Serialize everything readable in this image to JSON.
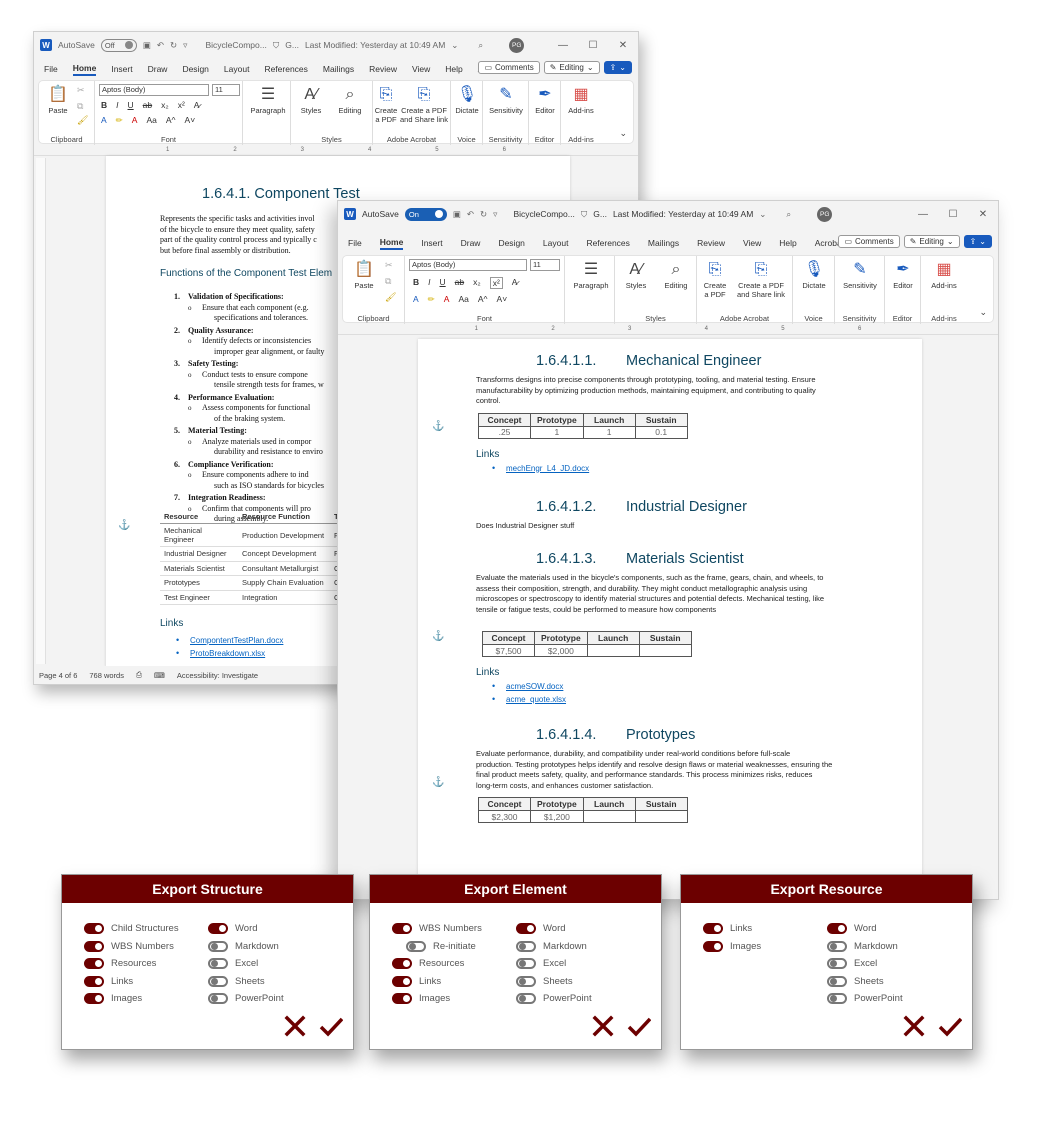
{
  "colors": {
    "accent": "#185abd",
    "dialog_header": "#6c0000",
    "heading": "#0f4761",
    "link": "#0563c1"
  },
  "word_common": {
    "autosave_label": "AutoSave",
    "title_short": "BicycleCompo...",
    "g_label": "G...",
    "last_modified": "Last Modified: Yesterday at 10:49 AM",
    "user_initials": "PG",
    "menu": [
      "File",
      "Home",
      "Insert",
      "Draw",
      "Design",
      "Layout",
      "References",
      "Mailings",
      "Review",
      "View",
      "Help",
      "Acrobat"
    ],
    "comments": "Comments",
    "editing": "Editing",
    "font_name": "Aptos (Body)",
    "font_size": "11",
    "ribbon": {
      "paste": "Paste",
      "paragraph": "Paragraph",
      "styles": "Styles",
      "editing": "Editing",
      "create_pdf_1": "Create",
      "create_pdf_2": "a PDF",
      "share_1": "Create a PDF",
      "share_2": "and Share link",
      "dictate": "Dictate",
      "sensitivity": "Sensitivity",
      "editor": "Editor",
      "addins": "Add-ins",
      "g_clipboard": "Clipboard",
      "g_font": "Font",
      "g_styles": "Styles",
      "g_acrobat": "Adobe Acrobat",
      "g_voice": "Voice",
      "g_sensitivity": "Sensitivity",
      "g_editor": "Editor",
      "g_addins": "Add-ins"
    }
  },
  "window1": {
    "autosave_state": "Off",
    "heading": "1.6.4.1.     Component Test",
    "intro": [
      "Represents the specific tasks and activities invol",
      "of the bicycle to ensure they meet quality, safety",
      "part of the quality control process and typically c",
      "but before final assembly or distribution."
    ],
    "functions_heading": "Functions of the Component Test Elem",
    "functions": [
      {
        "n": "1.",
        "title": "Validation of Specifications:",
        "sub": [
          "Ensure that each component (e.g.",
          "specifications and tolerances."
        ]
      },
      {
        "n": "2.",
        "title": "Quality Assurance:",
        "sub": [
          "Identify defects or inconsistencies",
          "improper gear alignment, or faulty"
        ]
      },
      {
        "n": "3.",
        "title": "Safety Testing:",
        "sub": [
          "Conduct tests to ensure compone",
          "tensile strength tests for frames, w"
        ]
      },
      {
        "n": "4.",
        "title": "Performance Evaluation:",
        "sub": [
          "Assess components for functional",
          "of the braking system."
        ]
      },
      {
        "n": "5.",
        "title": "Material Testing:",
        "sub": [
          "Analyze materials used in compor",
          "durability and resistance to enviro"
        ]
      },
      {
        "n": "6.",
        "title": "Compliance Verification:",
        "sub": [
          "Ensure components adhere to ind",
          "such as ISO standards for bicycles"
        ]
      },
      {
        "n": "7.",
        "title": "Integration Readiness:",
        "sub": [
          "Confirm that components will pro",
          "during assembly."
        ]
      }
    ],
    "res_headers": [
      "Resource",
      "Resource Function",
      "T"
    ],
    "res_rows": [
      [
        "Mechanical Engineer",
        "Production Development",
        "F"
      ],
      [
        "Industrial Designer",
        "Concept Development",
        "F"
      ],
      [
        "Materials Scientist",
        "Consultant Metallurgist",
        "C"
      ],
      [
        "Prototypes",
        "Supply Chain Evaluation",
        "C"
      ],
      [
        "Test Engineer",
        "Integration",
        "C"
      ]
    ],
    "links_heading": "Links",
    "links": [
      "CompontentTestPlan.docx",
      "ProtoBreakdown.xlsx"
    ],
    "status": [
      "Page 4 of 6",
      "768 words",
      "Accessibility: Investigate"
    ]
  },
  "window2": {
    "autosave_state": "On",
    "table_headers": [
      "Concept",
      "Prototype",
      "Launch",
      "Sustain"
    ],
    "sections": [
      {
        "num": "1.6.4.1.1.",
        "title": "Mechanical Engineer",
        "text": [
          "Transforms designs into precise components through prototyping, tooling, and material testing. Ensure",
          "manufacturability by optimizing production methods, maintaining equipment, and contributing to quality",
          "control."
        ],
        "values": [
          ".25",
          "1",
          "1",
          "0.1"
        ],
        "links_heading": "Links",
        "links": [
          "mechEngr_L4_JD.docx"
        ]
      },
      {
        "num": "1.6.4.1.2.",
        "title": "Industrial Designer",
        "text": [
          "Does Industrial Designer stuff"
        ]
      },
      {
        "num": "1.6.4.1.3.",
        "title": "Materials Scientist",
        "text": [
          "Evaluate the materials used in the bicycle's components, such as the frame, gears, chain, and wheels, to",
          "assess their composition, strength, and durability. They might conduct metallographic analysis using",
          "microscopes or spectroscopy to identify material structures and potential defects. Mechanical testing, like",
          "tensile or fatigue tests, could be performed to measure how components"
        ],
        "values": [
          "$7,500",
          "$2,000",
          "",
          ""
        ],
        "links_heading": "Links",
        "links": [
          "acmeSOW.docx",
          "acme_quote.xlsx"
        ]
      },
      {
        "num": "1.6.4.1.4.",
        "title": "Prototypes",
        "text": [
          "Evaluate performance, durability, and compatibility under real-world conditions before full-scale",
          "production. Testing prototypes helps identify and resolve design flaws or material weaknesses, ensuring the",
          "final product meets safety, quality, and performance standards. This process minimizes risks, reduces",
          "long-term costs, and enhances customer satisfaction."
        ],
        "values": [
          "$2,300",
          "$1,200",
          "",
          ""
        ]
      }
    ]
  },
  "dialogs": [
    {
      "title": "Export Structure",
      "left": [
        {
          "label": "Child Structures",
          "on": true
        },
        {
          "label": "WBS Numbers",
          "on": true
        },
        {
          "label": "Resources",
          "on": true
        },
        {
          "label": "Links",
          "on": true
        },
        {
          "label": "Images",
          "on": true
        }
      ],
      "right": [
        {
          "label": "Word",
          "on": true
        },
        {
          "label": "Markdown",
          "on": false
        },
        {
          "label": "Excel",
          "on": false
        },
        {
          "label": "Sheets",
          "on": false
        },
        {
          "label": "PowerPoint",
          "on": false
        }
      ]
    },
    {
      "title": "Export Element",
      "left": [
        {
          "label": "WBS Numbers",
          "on": true
        },
        {
          "label": "Re-initiate",
          "on": false,
          "indent": true
        },
        {
          "label": "Resources",
          "on": true
        },
        {
          "label": "Links",
          "on": true
        },
        {
          "label": "Images",
          "on": true
        }
      ],
      "right": [
        {
          "label": "Word",
          "on": true
        },
        {
          "label": "Markdown",
          "on": false
        },
        {
          "label": "Excel",
          "on": false
        },
        {
          "label": "Sheets",
          "on": false
        },
        {
          "label": "PowerPoint",
          "on": false
        }
      ]
    },
    {
      "title": "Export Resource",
      "left": [
        {
          "label": "Links",
          "on": true
        },
        {
          "label": "Images",
          "on": true
        }
      ],
      "right": [
        {
          "label": "Word",
          "on": true
        },
        {
          "label": "Markdown",
          "on": false
        },
        {
          "label": "Excel",
          "on": false
        },
        {
          "label": "Sheets",
          "on": false
        },
        {
          "label": "PowerPoint",
          "on": false
        }
      ]
    }
  ],
  "icons": {
    "cancel": "close-x-icon",
    "confirm": "checkmark-icon",
    "anchor": "anchor-icon"
  }
}
